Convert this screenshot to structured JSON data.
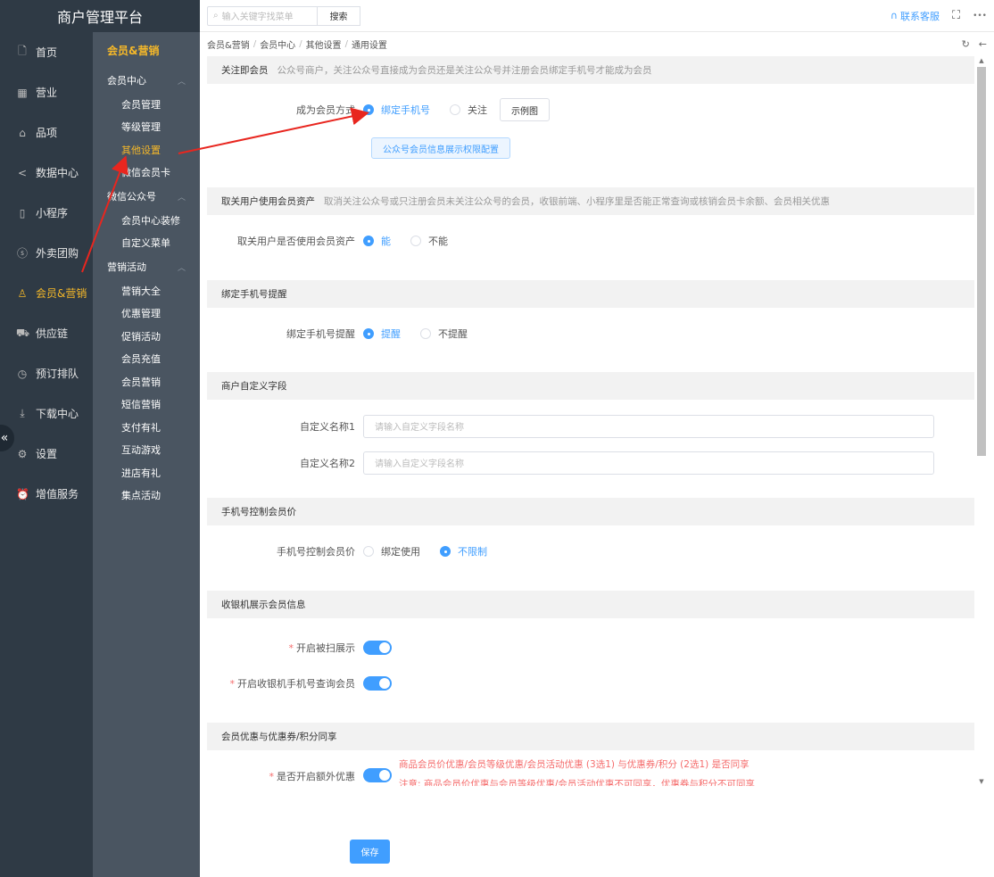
{
  "brand": {
    "title": "商户管理平台"
  },
  "topbar": {
    "search_placeholder": "输入关键字找菜单",
    "search_button": "搜索",
    "service_link": "联系客服",
    "fullscreen_icon": "⛶",
    "more_icon": "•••"
  },
  "side1": {
    "items": [
      {
        "label": "首页",
        "icon": "🗋"
      },
      {
        "label": "营业",
        "icon": "▦"
      },
      {
        "label": "品项",
        "icon": "⌂"
      },
      {
        "label": "数据中心",
        "icon": "<"
      },
      {
        "label": "小程序",
        "icon": "▯"
      },
      {
        "label": "外卖团购",
        "icon": "ⓢ"
      },
      {
        "label": "会员&营销",
        "icon": "♙"
      },
      {
        "label": "供应链",
        "icon": "⛟"
      },
      {
        "label": "预订排队",
        "icon": "◷"
      },
      {
        "label": "下载中心",
        "icon": "⤓"
      },
      {
        "label": "设置",
        "icon": "⚙"
      },
      {
        "label": "增值服务",
        "icon": "⏰"
      }
    ],
    "collapse_icon": "«"
  },
  "side2": {
    "title": "会员&营销",
    "group1": "会员中心",
    "group1_items": [
      "会员管理",
      "等级管理",
      "其他设置",
      "微信会员卡"
    ],
    "group2": "微信公众号",
    "group2_items": [
      "会员中心装修",
      "自定义菜单"
    ],
    "group3": "营销活动",
    "group3_items": [
      "营销大全",
      "优惠管理",
      "促销活动",
      "会员充值",
      "会员营销",
      "短信营销",
      "支付有礼",
      "互动游戏",
      "进店有礼",
      "集点活动"
    ]
  },
  "breadcrumb": {
    "c1": "会员&营销",
    "c2": "会员中心",
    "c3": "其他设置",
    "c4": "通用设置",
    "sep": "/",
    "refresh_icon": "↻",
    "back_icon": "←"
  },
  "sections": {
    "s1": {
      "title": "关注即会员",
      "desc": "公众号商户，关注公众号直接成为会员还是关注公众号并注册会员绑定手机号才能成为会员",
      "label": "成为会员方式",
      "opt1": "绑定手机号",
      "opt2": "关注",
      "example_btn": "示例图",
      "config_btn": "公众号会员信息展示权限配置"
    },
    "s2": {
      "title": "取关用户使用会员资产",
      "desc": "取消关注公众号或只注册会员未关注公众号的会员，收银前端、小程序里是否能正常查询或核销会员卡余额、会员相关优惠",
      "label": "取关用户是否使用会员资产",
      "opt1": "能",
      "opt2": "不能"
    },
    "s3": {
      "title": "绑定手机号提醒",
      "label": "绑定手机号提醒",
      "opt1": "提醒",
      "opt2": "不提醒"
    },
    "s4": {
      "title": "商户自定义字段",
      "label1": "自定义名称1",
      "label2": "自定义名称2",
      "placeholder": "请输入自定义字段名称"
    },
    "s5": {
      "title": "手机号控制会员价",
      "label": "手机号控制会员价",
      "opt1": "绑定使用",
      "opt2": "不限制"
    },
    "s6": {
      "title": "收银机展示会员信息",
      "req": "*",
      "label1": "开启被扫展示",
      "label2": "开启收银机手机号查询会员"
    },
    "s7": {
      "title": "会员优惠与优惠券/积分同享",
      "req": "*",
      "label": "是否开启额外优惠",
      "note1": "商品会员价优惠/会员等级优惠/会员活动优惠 (3选1) 与优惠券/积分 (2选1) 是否同享",
      "note2": "注意: 商品会员价优惠与会员等级优惠/会员活动优惠不可同享，优惠券与积分不可同享"
    }
  },
  "save_button": "保存",
  "colors": {
    "accent": "#409eff",
    "sidebar": "#2f3a45",
    "sidebar2": "#4a5561",
    "highlight": "#f5b829",
    "annotation": "#e8261f"
  }
}
